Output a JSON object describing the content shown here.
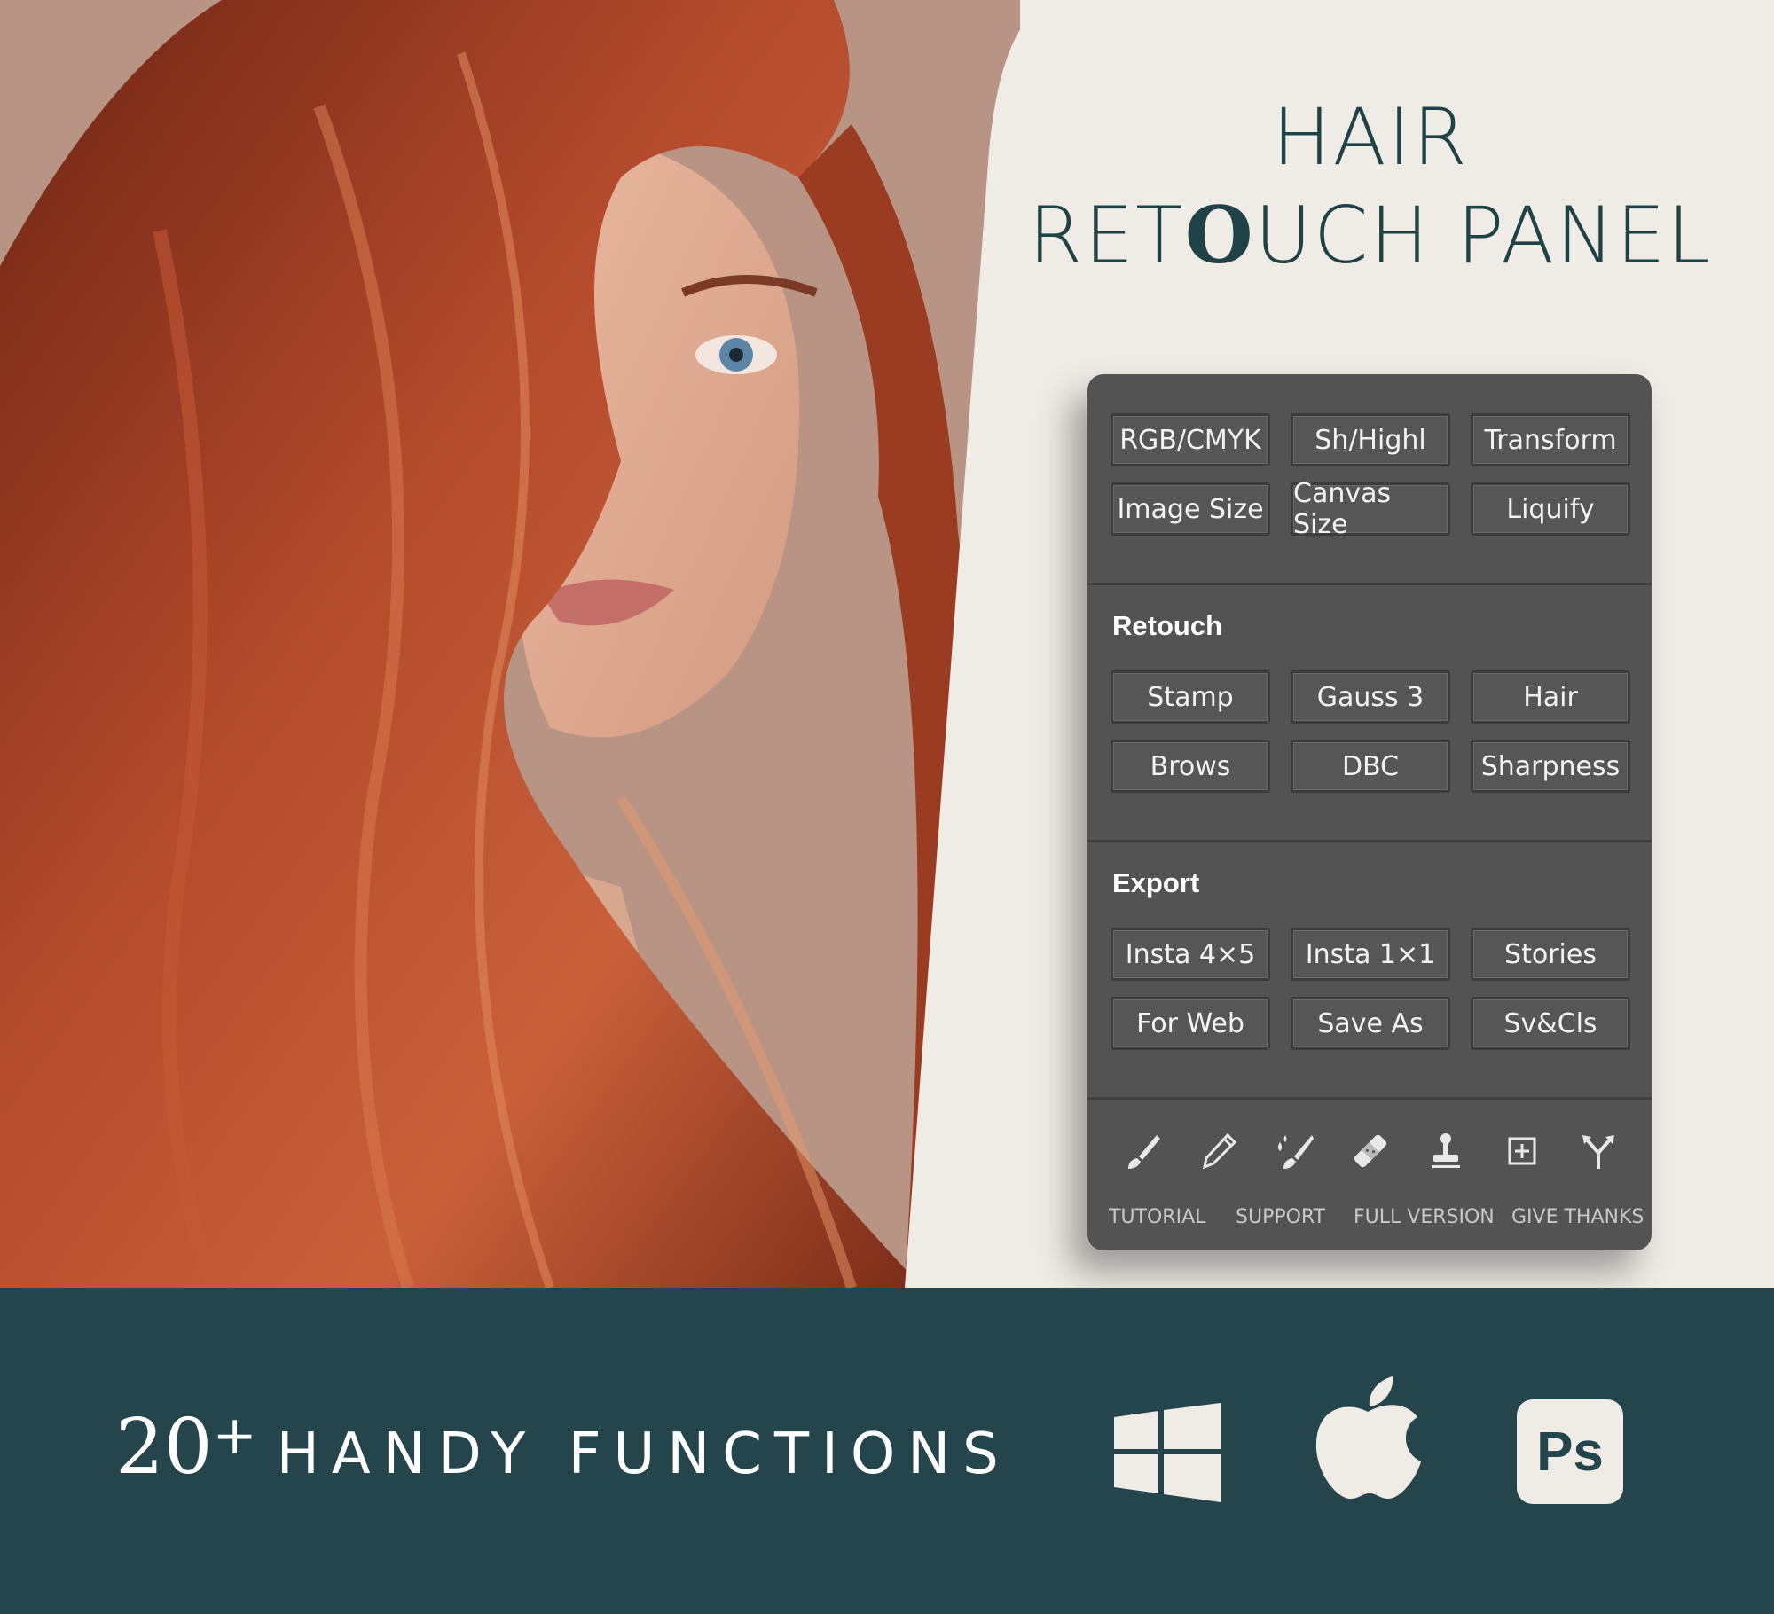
{
  "title": {
    "line1": "HAIR",
    "line2_pre": "RET",
    "line2_o": "O",
    "line2_post": "UCH PANEL"
  },
  "panel": {
    "top_buttons": [
      "RGB/CMYK",
      "Sh/Highl",
      "Transform",
      "Image Size",
      "Canvas Size",
      "Liquify"
    ],
    "retouch": {
      "title": "Retouch",
      "buttons": [
        "Stamp",
        "Gauss 3",
        "Hair",
        "Brows",
        "DBC",
        "Sharpness"
      ]
    },
    "export": {
      "title": "Export",
      "buttons": [
        "Insta 4×5",
        "Insta 1×1",
        "Stories",
        "For Web",
        "Save As",
        "Sv&Cls"
      ]
    },
    "tool_icons": [
      "brush-icon",
      "pencil-icon",
      "mixer-brush-icon",
      "bandage-icon",
      "stamp-icon",
      "add-layer-icon",
      "split-arrow-icon"
    ],
    "links": [
      "TUTORIAL",
      "SUPPORT",
      "FULL VERSION",
      "GIVE THANKS"
    ]
  },
  "band": {
    "number": "20",
    "plus": "+",
    "text": "HANDY FUNCTIONS",
    "ps_label": "Ps",
    "platform_icons": [
      "windows-icon",
      "apple-icon",
      "photoshop-icon"
    ]
  },
  "colors": {
    "background": "#efece6",
    "band": "#24454b",
    "title": "#1f4246",
    "panel": "#535353",
    "photo_bg": "#b89484",
    "hair": "#a8442a"
  }
}
